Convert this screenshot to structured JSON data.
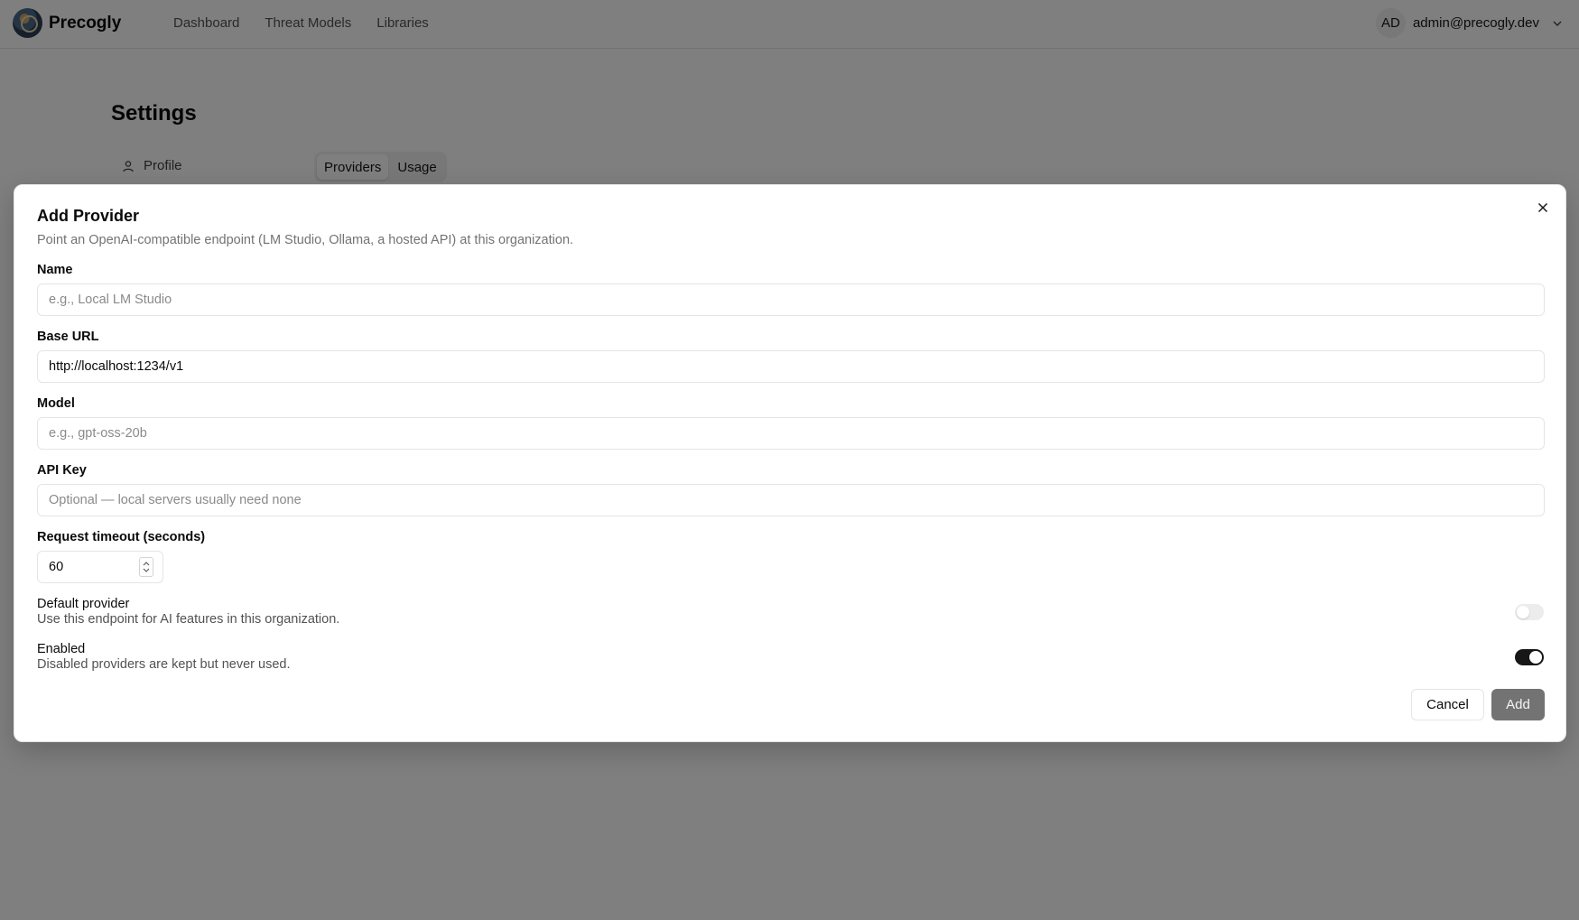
{
  "app": {
    "brand": "Precogly",
    "nav": [
      "Dashboard",
      "Threat Models",
      "Libraries"
    ],
    "user_initials": "AD",
    "user_email": "admin@precogly.dev"
  },
  "settings": {
    "title": "Settings",
    "sidebar_profile": "Profile",
    "tabs": [
      {
        "label": "Providers",
        "active": true
      },
      {
        "label": "Usage",
        "active": false
      }
    ]
  },
  "dialog": {
    "title": "Add Provider",
    "description": "Point an OpenAI-compatible endpoint (LM Studio, Ollama, a hosted API) at this organization.",
    "fields": {
      "name": {
        "label": "Name",
        "value": "",
        "placeholder": "e.g., Local LM Studio"
      },
      "base_url": {
        "label": "Base URL",
        "value": "http://localhost:1234/v1",
        "placeholder": ""
      },
      "model": {
        "label": "Model",
        "value": "",
        "placeholder": "e.g., gpt-oss-20b"
      },
      "api_key": {
        "label": "API Key",
        "value": "",
        "placeholder": "Optional — local servers usually need none"
      },
      "timeout": {
        "label": "Request timeout (seconds)",
        "value": "60"
      }
    },
    "switches": {
      "default_provider": {
        "title": "Default provider",
        "description": "Use this endpoint for AI features in this organization.",
        "on": false
      },
      "enabled": {
        "title": "Enabled",
        "description": "Disabled providers are kept but never used.",
        "on": true
      }
    },
    "buttons": {
      "cancel": "Cancel",
      "add": "Add"
    }
  }
}
